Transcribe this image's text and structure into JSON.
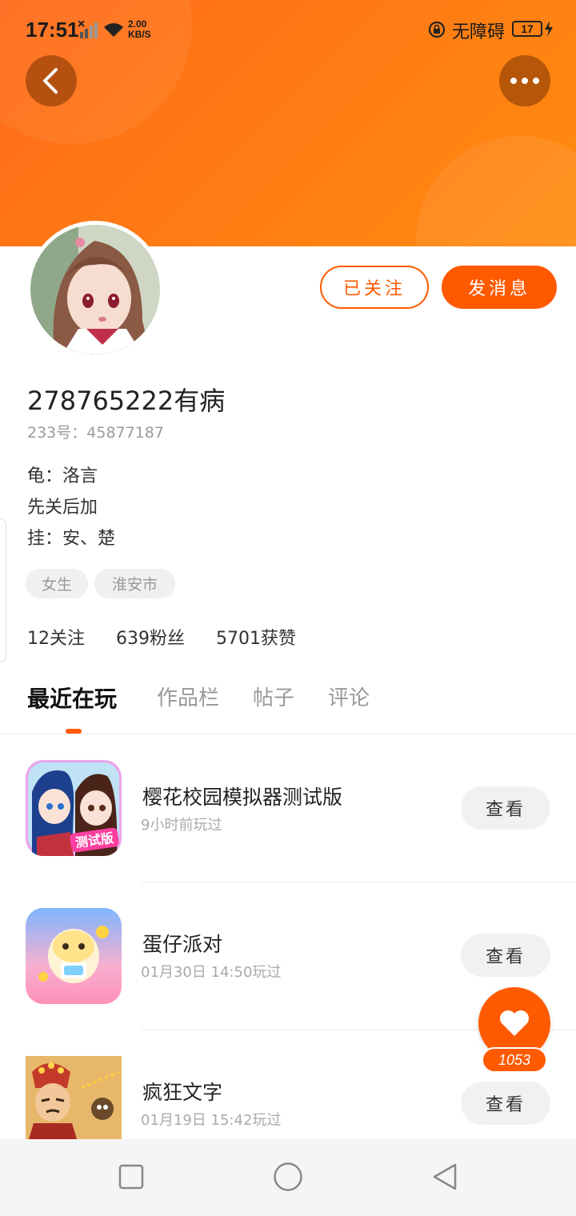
{
  "status_bar": {
    "time": "17:51",
    "net_speed_value": "2.00",
    "net_speed_unit": "KB/S",
    "accessibility_label": "无障碍",
    "battery_level": "17"
  },
  "header": {
    "accent_color": "#ff6a1a"
  },
  "profile": {
    "username": "278765222有病",
    "user_id": "233号：45877187",
    "bio_lines": [
      "龟：洛言",
      "先关后加",
      "挂：安、楚"
    ],
    "tags": [
      "女生",
      "淮安市"
    ],
    "stats": {
      "following": "12关注",
      "followers": "639粉丝",
      "likes": "5701获赞"
    },
    "followed_label": "已关注",
    "message_label": "发消息"
  },
  "tabs": [
    "最近在玩",
    "作品栏",
    "帖子",
    "评论"
  ],
  "active_tab": "最近在玩",
  "games": [
    {
      "title": "樱花校园模拟器测试版",
      "last_played": "9小时前玩过",
      "button": "查看",
      "icon_badge": "测试版"
    },
    {
      "title": "蛋仔派对",
      "last_played": "01月30日 14:50玩过",
      "button": "查看"
    },
    {
      "title": "疯狂文字",
      "last_played": "01月19日 15:42玩过",
      "button": "查看"
    }
  ],
  "like_fab": {
    "count": "1053"
  }
}
